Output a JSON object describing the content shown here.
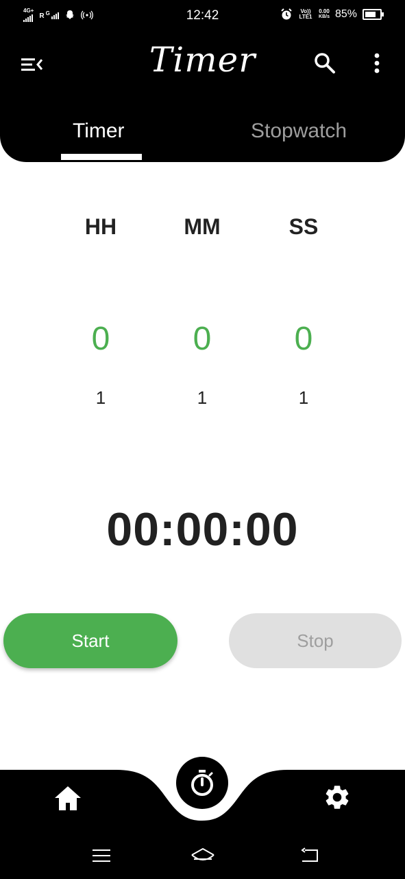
{
  "status_bar": {
    "network_left": "4G+",
    "network_roaming": "R",
    "network_g": "G",
    "time": "12:42",
    "volte": "Vo)) LTE1",
    "data_speed": "0.00",
    "data_unit": "KB/s",
    "battery": "85%",
    "battery_level": 0.85
  },
  "header": {
    "title": "Timer",
    "menu_icon": "menu-collapse-icon",
    "search_icon": "search-icon",
    "more_icon": "more-vert-icon"
  },
  "tabs": [
    {
      "label": "Timer",
      "active": true
    },
    {
      "label": "Stopwatch",
      "active": false
    }
  ],
  "picker": {
    "columns": [
      {
        "label": "HH",
        "value": "0",
        "next": "1"
      },
      {
        "label": "MM",
        "value": "0",
        "next": "1"
      },
      {
        "label": "SS",
        "value": "0",
        "next": "1"
      }
    ]
  },
  "display": {
    "time": "00:00:00"
  },
  "buttons": {
    "start": "Start",
    "stop": "Stop"
  },
  "bottom_nav": {
    "home_icon": "home-icon",
    "timer_icon": "stopwatch-icon",
    "settings_icon": "gear-icon"
  },
  "colors": {
    "accent": "#4caf50",
    "header_bg": "#000000",
    "disabled_bg": "#e0e0e0",
    "disabled_text": "#9e9e9e"
  }
}
